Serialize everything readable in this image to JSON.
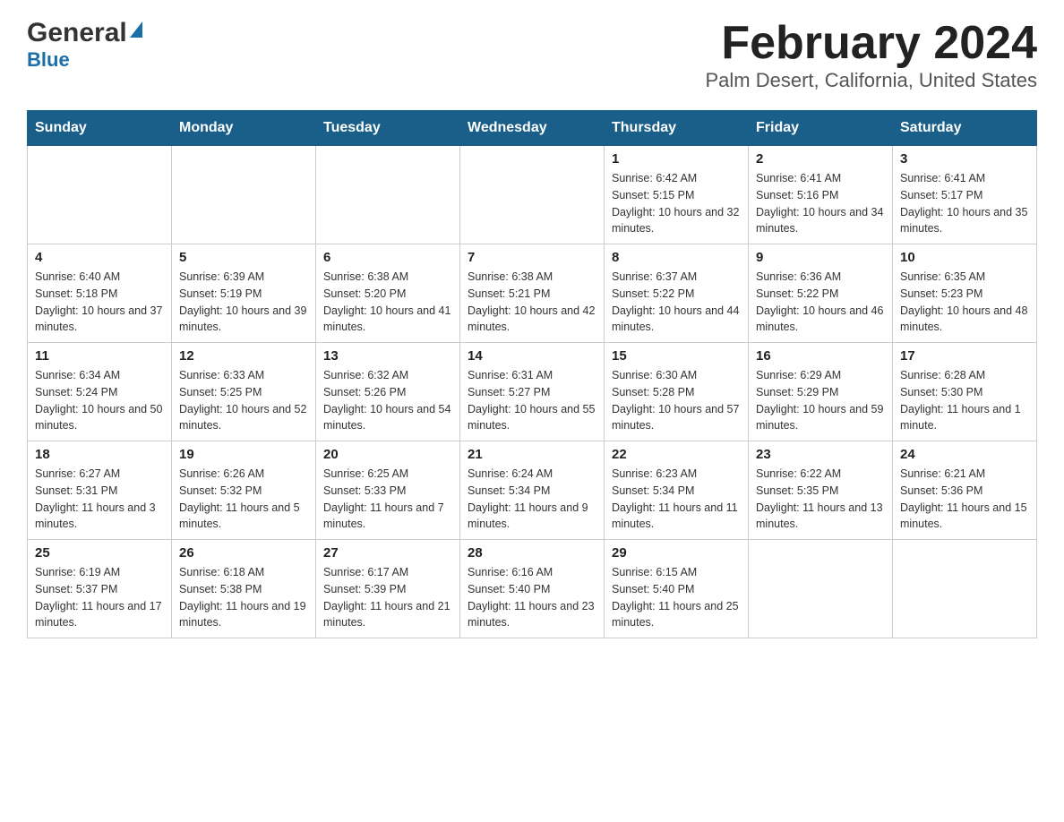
{
  "logo": {
    "general": "General",
    "blue": "Blue"
  },
  "header": {
    "month": "February 2024",
    "location": "Palm Desert, California, United States"
  },
  "weekdays": [
    "Sunday",
    "Monday",
    "Tuesday",
    "Wednesday",
    "Thursday",
    "Friday",
    "Saturday"
  ],
  "weeks": [
    [
      {
        "day": "",
        "info": ""
      },
      {
        "day": "",
        "info": ""
      },
      {
        "day": "",
        "info": ""
      },
      {
        "day": "",
        "info": ""
      },
      {
        "day": "1",
        "info": "Sunrise: 6:42 AM\nSunset: 5:15 PM\nDaylight: 10 hours and 32 minutes."
      },
      {
        "day": "2",
        "info": "Sunrise: 6:41 AM\nSunset: 5:16 PM\nDaylight: 10 hours and 34 minutes."
      },
      {
        "day": "3",
        "info": "Sunrise: 6:41 AM\nSunset: 5:17 PM\nDaylight: 10 hours and 35 minutes."
      }
    ],
    [
      {
        "day": "4",
        "info": "Sunrise: 6:40 AM\nSunset: 5:18 PM\nDaylight: 10 hours and 37 minutes."
      },
      {
        "day": "5",
        "info": "Sunrise: 6:39 AM\nSunset: 5:19 PM\nDaylight: 10 hours and 39 minutes."
      },
      {
        "day": "6",
        "info": "Sunrise: 6:38 AM\nSunset: 5:20 PM\nDaylight: 10 hours and 41 minutes."
      },
      {
        "day": "7",
        "info": "Sunrise: 6:38 AM\nSunset: 5:21 PM\nDaylight: 10 hours and 42 minutes."
      },
      {
        "day": "8",
        "info": "Sunrise: 6:37 AM\nSunset: 5:22 PM\nDaylight: 10 hours and 44 minutes."
      },
      {
        "day": "9",
        "info": "Sunrise: 6:36 AM\nSunset: 5:22 PM\nDaylight: 10 hours and 46 minutes."
      },
      {
        "day": "10",
        "info": "Sunrise: 6:35 AM\nSunset: 5:23 PM\nDaylight: 10 hours and 48 minutes."
      }
    ],
    [
      {
        "day": "11",
        "info": "Sunrise: 6:34 AM\nSunset: 5:24 PM\nDaylight: 10 hours and 50 minutes."
      },
      {
        "day": "12",
        "info": "Sunrise: 6:33 AM\nSunset: 5:25 PM\nDaylight: 10 hours and 52 minutes."
      },
      {
        "day": "13",
        "info": "Sunrise: 6:32 AM\nSunset: 5:26 PM\nDaylight: 10 hours and 54 minutes."
      },
      {
        "day": "14",
        "info": "Sunrise: 6:31 AM\nSunset: 5:27 PM\nDaylight: 10 hours and 55 minutes."
      },
      {
        "day": "15",
        "info": "Sunrise: 6:30 AM\nSunset: 5:28 PM\nDaylight: 10 hours and 57 minutes."
      },
      {
        "day": "16",
        "info": "Sunrise: 6:29 AM\nSunset: 5:29 PM\nDaylight: 10 hours and 59 minutes."
      },
      {
        "day": "17",
        "info": "Sunrise: 6:28 AM\nSunset: 5:30 PM\nDaylight: 11 hours and 1 minute."
      }
    ],
    [
      {
        "day": "18",
        "info": "Sunrise: 6:27 AM\nSunset: 5:31 PM\nDaylight: 11 hours and 3 minutes."
      },
      {
        "day": "19",
        "info": "Sunrise: 6:26 AM\nSunset: 5:32 PM\nDaylight: 11 hours and 5 minutes."
      },
      {
        "day": "20",
        "info": "Sunrise: 6:25 AM\nSunset: 5:33 PM\nDaylight: 11 hours and 7 minutes."
      },
      {
        "day": "21",
        "info": "Sunrise: 6:24 AM\nSunset: 5:34 PM\nDaylight: 11 hours and 9 minutes."
      },
      {
        "day": "22",
        "info": "Sunrise: 6:23 AM\nSunset: 5:34 PM\nDaylight: 11 hours and 11 minutes."
      },
      {
        "day": "23",
        "info": "Sunrise: 6:22 AM\nSunset: 5:35 PM\nDaylight: 11 hours and 13 minutes."
      },
      {
        "day": "24",
        "info": "Sunrise: 6:21 AM\nSunset: 5:36 PM\nDaylight: 11 hours and 15 minutes."
      }
    ],
    [
      {
        "day": "25",
        "info": "Sunrise: 6:19 AM\nSunset: 5:37 PM\nDaylight: 11 hours and 17 minutes."
      },
      {
        "day": "26",
        "info": "Sunrise: 6:18 AM\nSunset: 5:38 PM\nDaylight: 11 hours and 19 minutes."
      },
      {
        "day": "27",
        "info": "Sunrise: 6:17 AM\nSunset: 5:39 PM\nDaylight: 11 hours and 21 minutes."
      },
      {
        "day": "28",
        "info": "Sunrise: 6:16 AM\nSunset: 5:40 PM\nDaylight: 11 hours and 23 minutes."
      },
      {
        "day": "29",
        "info": "Sunrise: 6:15 AM\nSunset: 5:40 PM\nDaylight: 11 hours and 25 minutes."
      },
      {
        "day": "",
        "info": ""
      },
      {
        "day": "",
        "info": ""
      }
    ]
  ]
}
